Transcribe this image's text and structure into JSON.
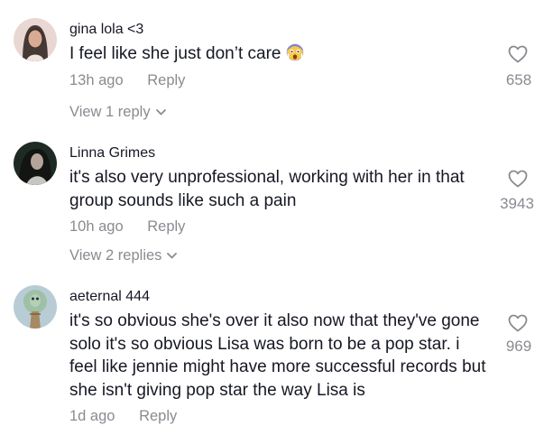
{
  "comments": [
    {
      "username": "gina lola <3",
      "text": "I feel like she just don’t care",
      "emoji_icon": "scared-face-emoji-icon",
      "time": "13h ago",
      "reply_label": "Reply",
      "likes": "658",
      "view_replies": "View 1 reply"
    },
    {
      "username": "Linna Grimes",
      "text": "it's also very unprofessional, working with her in that group sounds like such a pain",
      "time": "10h ago",
      "reply_label": "Reply",
      "likes": "3943",
      "view_replies": "View 2 replies"
    },
    {
      "username": "aeternal 444",
      "text": "it's so obvious she's over it also now that they've gone solo it's so obvious Lisa was born to be a pop star. i feel like jennie might have more successful records but she isn't giving pop star the way Lisa is",
      "time": "1d ago",
      "reply_label": "Reply",
      "likes": "969"
    }
  ],
  "colors": {
    "primary_text": "#161823",
    "secondary_text": "#8a8b91",
    "background": "#ffffff"
  }
}
